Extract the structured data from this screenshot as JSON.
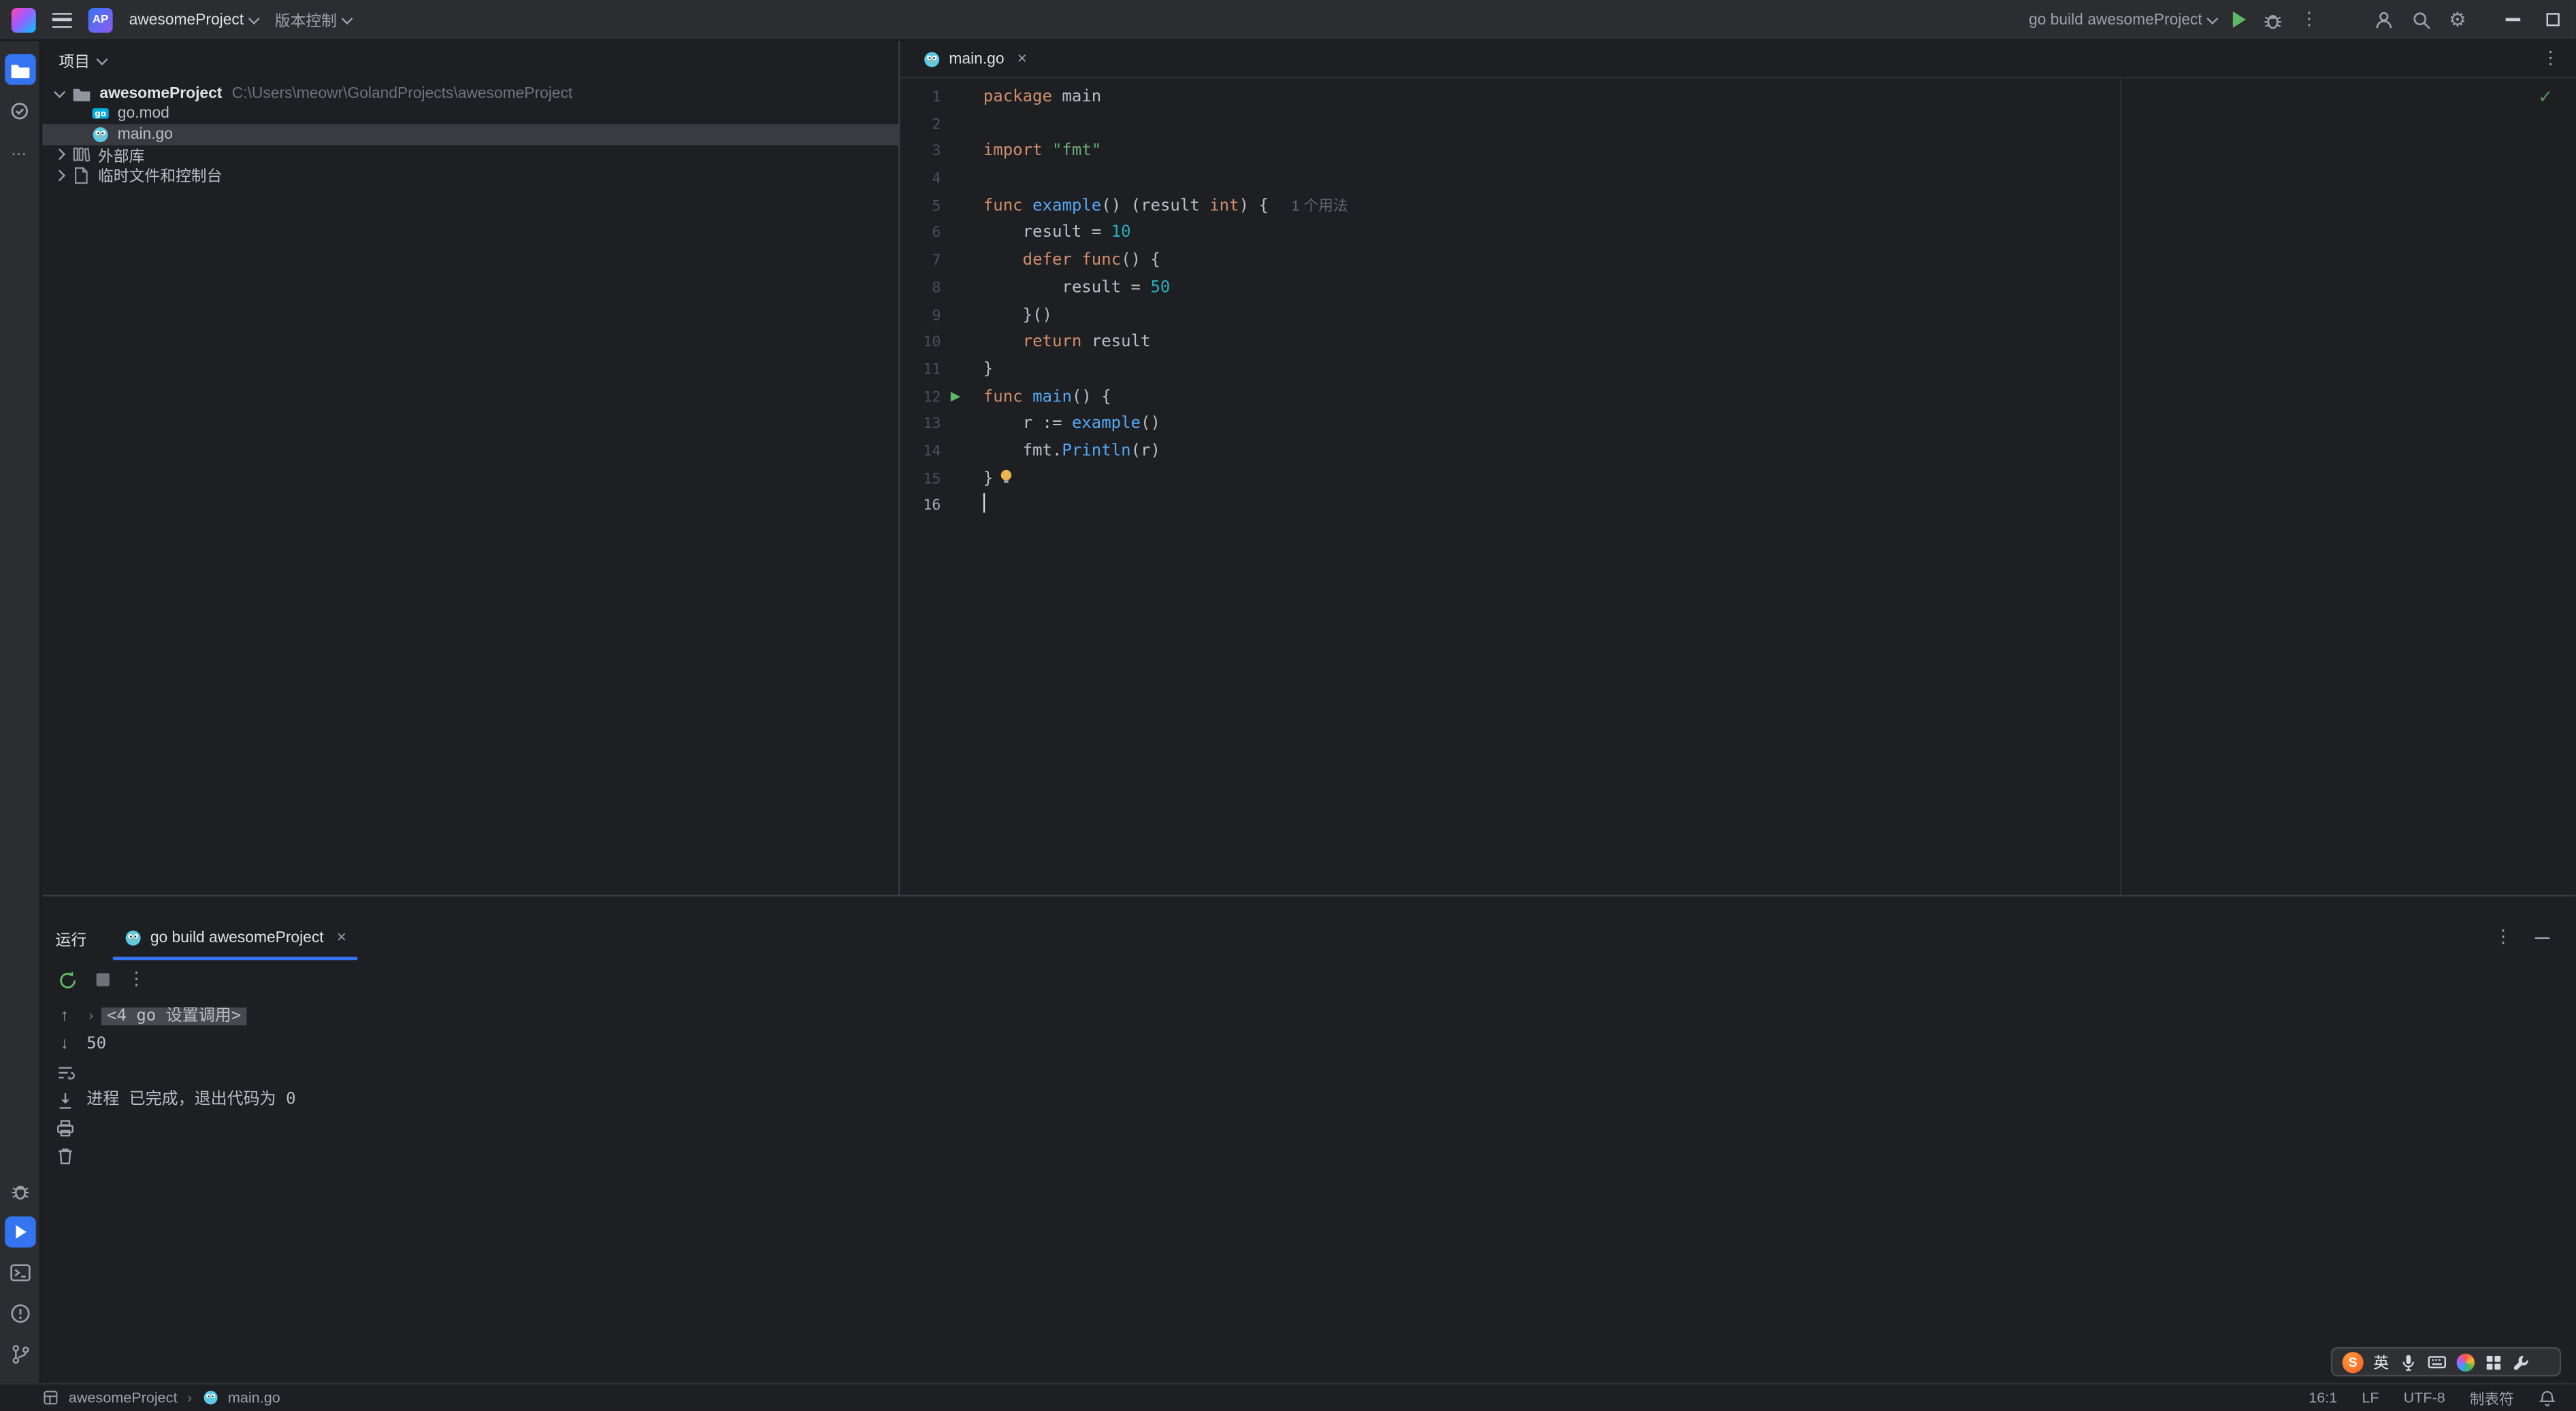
{
  "colors": {
    "accent": "#3574f0",
    "run_green": "#5fb865",
    "keyword": "#cf8e6d",
    "string": "#6aab73",
    "number": "#2aacb8",
    "function": "#56a8f5"
  },
  "titlebar": {
    "project_badge": "AP",
    "project_name": "awesomeProject",
    "vcs_label": "版本控制",
    "run_config": "go build awesomeProject"
  },
  "project_panel": {
    "header": "项目",
    "root_name": "awesomeProject",
    "root_path": "C:\\Users\\meowr\\GolandProjects\\awesomeProject",
    "files": [
      {
        "name": "go.mod"
      },
      {
        "name": "main.go"
      }
    ],
    "external_libraries": "外部库",
    "scratches_and_consoles": "临时文件和控制台"
  },
  "editor": {
    "tab": "main.go",
    "code": [
      {
        "n": "1",
        "tokens": [
          {
            "c": "kw",
            "t": "package"
          },
          {
            "c": "pl",
            "t": " main"
          }
        ]
      },
      {
        "n": "2",
        "tokens": []
      },
      {
        "n": "3",
        "tokens": [
          {
            "c": "kw",
            "t": "import"
          },
          {
            "c": "pl",
            "t": " "
          },
          {
            "c": "str",
            "t": "\"fmt\""
          }
        ]
      },
      {
        "n": "4",
        "tokens": []
      },
      {
        "n": "5",
        "tokens": [
          {
            "c": "kw",
            "t": "func"
          },
          {
            "c": "pl",
            "t": " "
          },
          {
            "c": "fn",
            "t": "example"
          },
          {
            "c": "pl",
            "t": "() (result "
          },
          {
            "c": "kw",
            "t": "int"
          },
          {
            "c": "pl",
            "t": ") { "
          }
        ],
        "hint": "1 个用法"
      },
      {
        "n": "6",
        "tokens": [
          {
            "c": "pl",
            "t": "    result = "
          },
          {
            "c": "num",
            "t": "10"
          }
        ]
      },
      {
        "n": "7",
        "tokens": [
          {
            "c": "pl",
            "t": "    "
          },
          {
            "c": "kw",
            "t": "defer"
          },
          {
            "c": "pl",
            "t": " "
          },
          {
            "c": "kw",
            "t": "func"
          },
          {
            "c": "pl",
            "t": "() {"
          }
        ]
      },
      {
        "n": "8",
        "tokens": [
          {
            "c": "pl",
            "t": "        result = "
          },
          {
            "c": "num",
            "t": "50"
          }
        ]
      },
      {
        "n": "9",
        "tokens": [
          {
            "c": "pl",
            "t": "    }()"
          }
        ]
      },
      {
        "n": "10",
        "tokens": [
          {
            "c": "pl",
            "t": "    "
          },
          {
            "c": "kw",
            "t": "return"
          },
          {
            "c": "pl",
            "t": " result"
          }
        ]
      },
      {
        "n": "11",
        "tokens": [
          {
            "c": "pl",
            "t": "}"
          }
        ]
      },
      {
        "n": "12",
        "run": true,
        "tokens": [
          {
            "c": "kw",
            "t": "func"
          },
          {
            "c": "pl",
            "t": " "
          },
          {
            "c": "fn",
            "t": "main"
          },
          {
            "c": "pl",
            "t": "() {"
          }
        ]
      },
      {
        "n": "13",
        "tokens": [
          {
            "c": "pl",
            "t": "    r := "
          },
          {
            "c": "fn",
            "t": "example"
          },
          {
            "c": "pl",
            "t": "()"
          }
        ]
      },
      {
        "n": "14",
        "tokens": [
          {
            "c": "pl",
            "t": "    fmt."
          },
          {
            "c": "fn",
            "t": "Println"
          },
          {
            "c": "pl",
            "t": "(r)"
          }
        ]
      },
      {
        "n": "15",
        "bulb": true,
        "tokens": [
          {
            "c": "pl",
            "t": "}"
          }
        ]
      },
      {
        "n": "16",
        "caret": true,
        "tokens": []
      }
    ]
  },
  "run_panel": {
    "title": "运行",
    "tab": "go build awesomeProject",
    "console": {
      "folded": "<4 go 设置调用>",
      "stdout": "50",
      "exit": "进程 已完成，退出代码为 0"
    }
  },
  "statusbar": {
    "breadcrumb_project": "awesomeProject",
    "breadcrumb_file": "main.go",
    "caret_position": "16:1",
    "line_separator": "LF",
    "encoding": "UTF-8",
    "indent_style": "制表符"
  },
  "ime": {
    "logo": "S",
    "lang": "英"
  }
}
